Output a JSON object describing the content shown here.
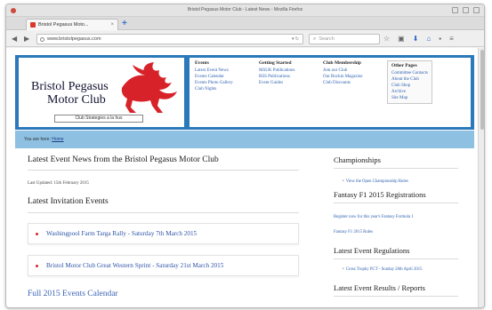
{
  "window": {
    "title": "Bristol Pegasus Motor Club - Latest News - Mozilla Firefox"
  },
  "tab": {
    "label": "Bristol Pegasus Moto...",
    "close": "×",
    "new_tab": "+"
  },
  "navbar": {
    "url": "www.bristolpegasus.com",
    "search_placeholder": "Search"
  },
  "site": {
    "name_line1": "Bristol Pegasus",
    "name_line2": "Motor Club",
    "tagline": "Club Strategies a la hus"
  },
  "menu": {
    "columns": [
      {
        "head": "Events",
        "items": [
          "Latest Event News",
          "Events Calendar",
          "Events Photo Gallery",
          "Club Nights"
        ]
      },
      {
        "head": "Getting Started",
        "items": [
          "MSUK Publications",
          "RSS Publications",
          "Event Guides"
        ]
      },
      {
        "head": "Club Membership",
        "items": [
          "Join our Club",
          "Our Rockin Magazine",
          "Club Discounts"
        ]
      },
      {
        "head": "Other Pages",
        "items": [
          "Committee Contacts",
          "About the Club",
          "Club Shop",
          "Archive",
          "Site Map"
        ]
      }
    ]
  },
  "breadcrumb": {
    "prefix": "You are here:",
    "link": "Home"
  },
  "main": {
    "news_title": "Latest Event News from the Bristol Pegasus Motor Club",
    "updated": "Last Updated: 15th February 2015",
    "invitation_title": "Latest Invitation Events",
    "events": [
      "Washingpool Farm Targa Rally - Saturday 7th March 2015",
      "Bristol Motor Club Great Western Sprint - Saturday 21st March 2015"
    ],
    "calendar_title": "Full 2015 Events Calendar"
  },
  "sidebar": {
    "championships_title": "Championships",
    "championships_link": "View the Open Championship Rules",
    "fantasy_title": "Fantasy F1 2015 Registrations",
    "fantasy_links": [
      "Register now for this year's Fantasy Formula 1",
      "Fantasy F1 2015 Rules"
    ],
    "regs_title": "Latest Event Regulations",
    "regs_link": "Cross Trophy PCT - Sunday 26th April 2015",
    "results_title": "Latest Event Results / Reports"
  },
  "colors": {
    "header_blue": "#2a79bb",
    "breadcrumb_blue": "#8ec0e2",
    "logo_red": "#d8222a",
    "link_blue": "#3062b0"
  }
}
